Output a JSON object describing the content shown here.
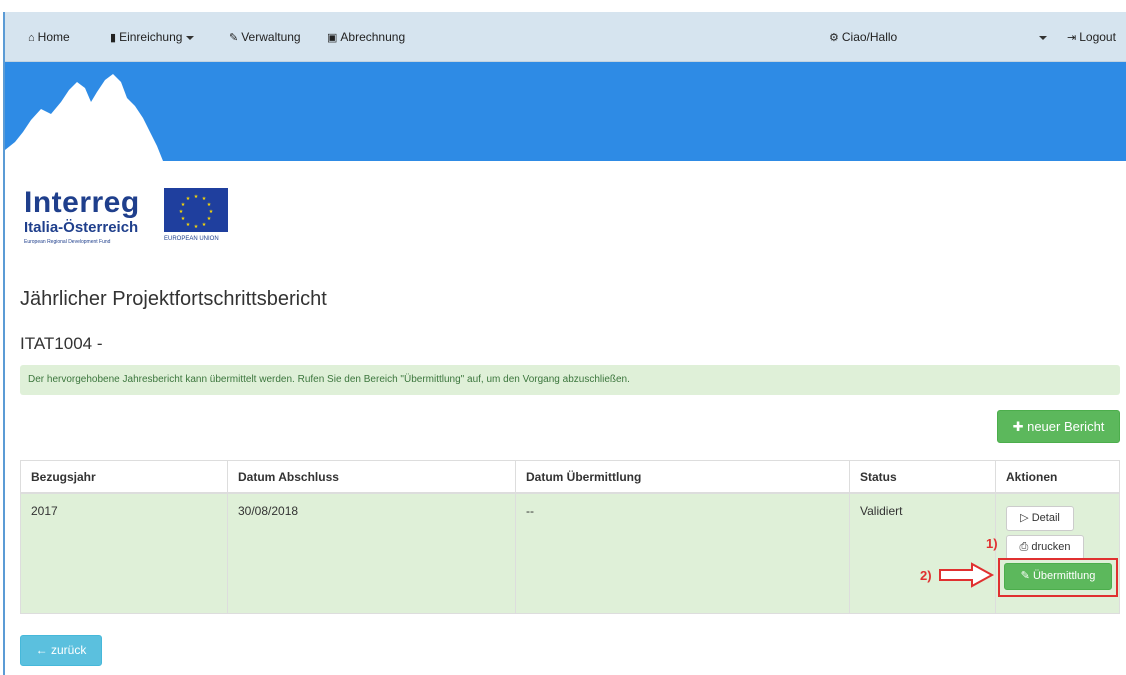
{
  "navbar": {
    "home": "Home",
    "einreichung": "Einreichung",
    "verwaltung": "Verwaltung",
    "abrechnung": "Abrechnung",
    "greeting": "Ciao/Hallo",
    "logout": "Logout"
  },
  "logo": {
    "word": "Interreg",
    "sub": "Italia-Österreich",
    "fund": "European Regional Development Fund",
    "eu": "EUROPEAN UNION"
  },
  "page": {
    "title": "Jährlicher Projektfortschrittsbericht",
    "subtitle": "ITAT1004 -",
    "alert": "Der hervorgehobene Jahresbericht kann übermittelt werden. Rufen Sie den Bereich \"Übermittlung\" auf, um den Vorgang abzuschließen.",
    "new_report": "neuer Bericht",
    "back": "zurück"
  },
  "table": {
    "headers": [
      "Bezugsjahr",
      "Datum Abschluss",
      "Datum Übermittlung",
      "Status",
      "Aktionen"
    ],
    "row": {
      "year": "2017",
      "closing_date": "30/08/2018",
      "submission_date": "--",
      "status": "Validiert"
    },
    "actions": {
      "detail": "Detail",
      "print": "drucken",
      "submit": "Übermittlung"
    }
  },
  "annotations": {
    "one": "1)",
    "two": "2)"
  },
  "colors": {
    "navbar_bg": "#d6e4ef",
    "banner": "#2e8be5",
    "success": "#5cb85c",
    "info": "#5bc0de",
    "highlight": "#e03030"
  }
}
